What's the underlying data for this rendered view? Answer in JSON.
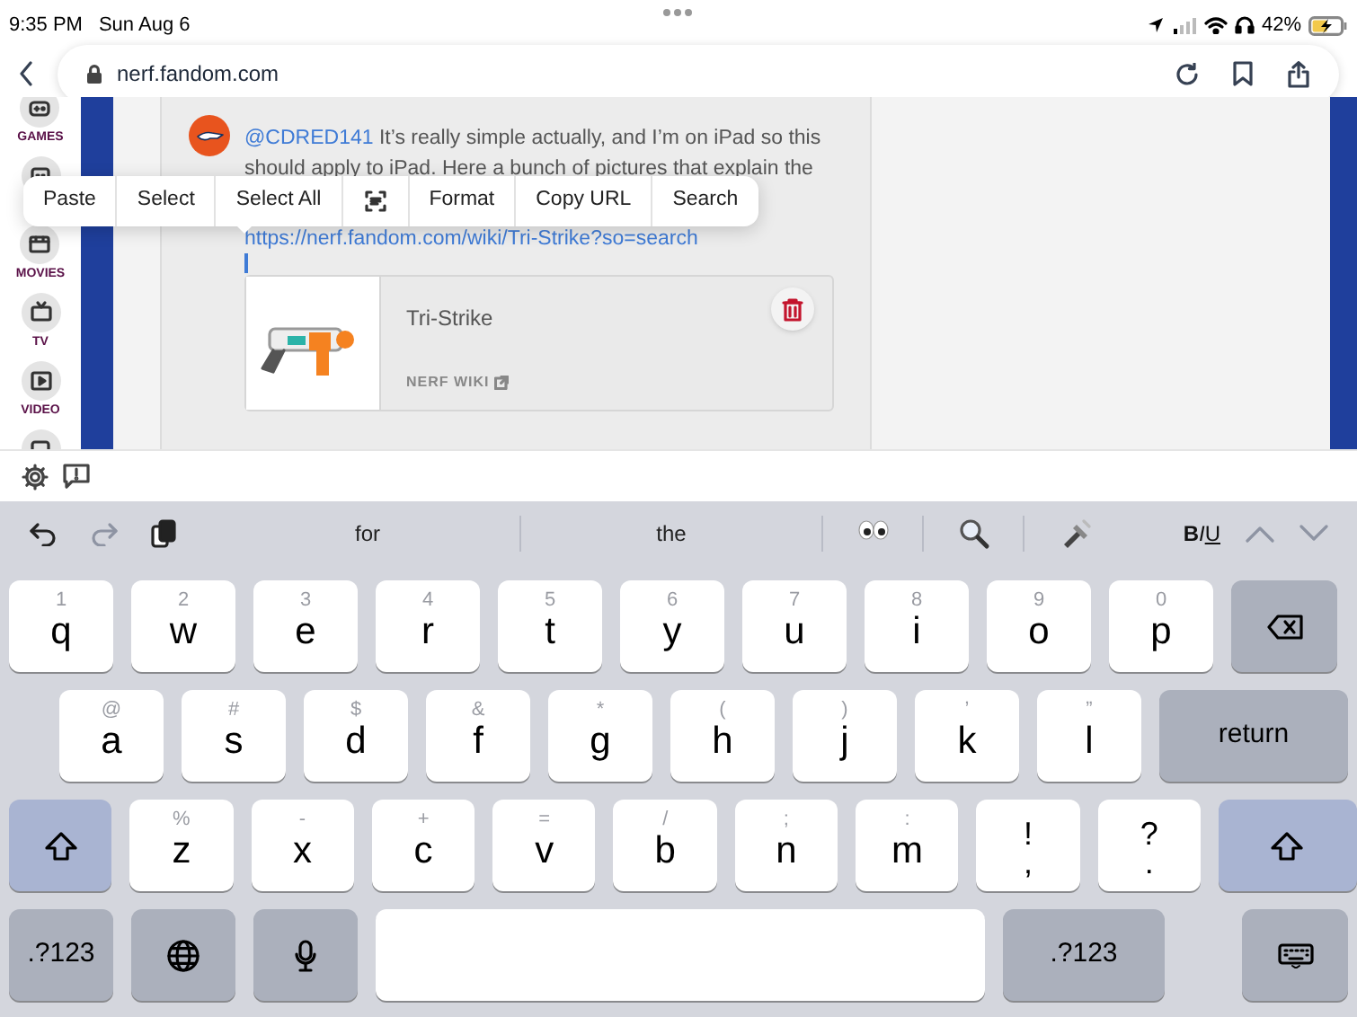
{
  "status_bar": {
    "time": "9:35 PM",
    "date": "Sun Aug 6",
    "battery": "42%"
  },
  "address_bar": {
    "url": "nerf.fandom.com"
  },
  "sidebar": {
    "items": [
      {
        "label": "GAMES",
        "kind": "games"
      },
      {
        "label": "MOVIES",
        "kind": "movies"
      },
      {
        "label": "TV",
        "kind": "tv"
      },
      {
        "label": "VIDEO",
        "kind": "video"
      }
    ]
  },
  "comment": {
    "mention": "@CDRED141",
    "text": " It’s really simple actually, and I’m on iPad so this should apply to iPad. Here a bunch of pictures that explain the",
    "link": "https://nerf.fandom.com/wiki/Tri-Strike?so=search"
  },
  "link_preview": {
    "title": "Tri-Strike",
    "source": "NERF WIKI"
  },
  "context_menu": {
    "items": [
      {
        "kind": "text",
        "label": "Paste"
      },
      {
        "kind": "text",
        "label": "Select"
      },
      {
        "kind": "text",
        "label": "Select All"
      },
      {
        "kind": "scan"
      },
      {
        "kind": "text",
        "label": "Format"
      },
      {
        "kind": "text",
        "label": "Copy URL"
      },
      {
        "kind": "text",
        "label": "Search"
      }
    ]
  },
  "keyboard": {
    "suggestions": [
      {
        "kind": "word",
        "text": "for"
      },
      {
        "kind": "word",
        "text": "the"
      },
      {
        "kind": "eyes"
      },
      {
        "kind": "magnifier"
      },
      {
        "kind": "flashlight"
      }
    ],
    "format": [
      "B",
      "I",
      "U"
    ],
    "rows": [
      [
        {
          "kind": "letter",
          "main": "q",
          "alt": "1"
        },
        {
          "kind": "letter",
          "main": "w",
          "alt": "2"
        },
        {
          "kind": "letter",
          "main": "e",
          "alt": "3"
        },
        {
          "kind": "letter",
          "main": "r",
          "alt": "4"
        },
        {
          "kind": "letter",
          "main": "t",
          "alt": "5"
        },
        {
          "kind": "letter",
          "main": "y",
          "alt": "6"
        },
        {
          "kind": "letter",
          "main": "u",
          "alt": "7"
        },
        {
          "kind": "letter",
          "main": "i",
          "alt": "8"
        },
        {
          "kind": "letter",
          "main": "o",
          "alt": "9"
        },
        {
          "kind": "letter",
          "main": "p",
          "alt": "0"
        },
        {
          "kind": "backspace"
        }
      ],
      [
        {
          "kind": "letter",
          "main": "a",
          "alt": "@"
        },
        {
          "kind": "letter",
          "main": "s",
          "alt": "#"
        },
        {
          "kind": "letter",
          "main": "d",
          "alt": "$"
        },
        {
          "kind": "letter",
          "main": "f",
          "alt": "&"
        },
        {
          "kind": "letter",
          "main": "g",
          "alt": "*"
        },
        {
          "kind": "letter",
          "main": "h",
          "alt": "("
        },
        {
          "kind": "letter",
          "main": "j",
          "alt": ")"
        },
        {
          "kind": "letter",
          "main": "k",
          "alt": "’"
        },
        {
          "kind": "letter",
          "main": "l",
          "alt": "”"
        },
        {
          "kind": "return",
          "label": "return"
        }
      ],
      [
        {
          "kind": "shift"
        },
        {
          "kind": "letter",
          "main": "z",
          "alt": "%"
        },
        {
          "kind": "letter",
          "main": "x",
          "alt": "-"
        },
        {
          "kind": "letter",
          "main": "c",
          "alt": "+"
        },
        {
          "kind": "letter",
          "main": "v",
          "alt": "="
        },
        {
          "kind": "letter",
          "main": "b",
          "alt": "/"
        },
        {
          "kind": "letter",
          "main": "n",
          "alt": ";"
        },
        {
          "kind": "letter",
          "main": "m",
          "alt": ":"
        },
        {
          "kind": "dual",
          "top": "!",
          "bottom": ","
        },
        {
          "kind": "dual",
          "top": "?",
          "bottom": "."
        },
        {
          "kind": "shift"
        }
      ],
      [
        {
          "kind": "mode",
          "label": ".?123"
        },
        {
          "kind": "globe"
        },
        {
          "kind": "mic"
        },
        {
          "kind": "space"
        },
        {
          "kind": "mode",
          "label": ".?123"
        },
        {
          "kind": "hide"
        }
      ]
    ]
  }
}
